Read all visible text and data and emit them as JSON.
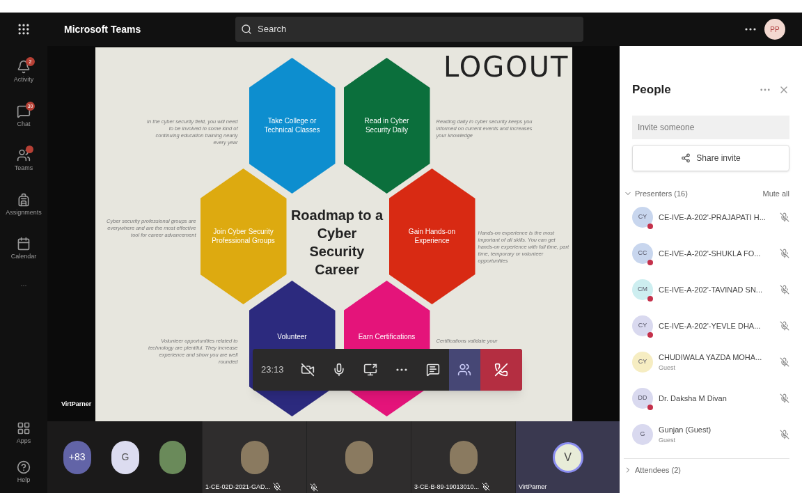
{
  "app": {
    "title": "Microsoft Teams",
    "search_placeholder": "Search",
    "user_initials": "PP"
  },
  "rail": [
    {
      "label": "Activity",
      "badge": "2"
    },
    {
      "label": "Chat",
      "badge": "30"
    },
    {
      "label": "Teams",
      "badge_dot": true
    },
    {
      "label": "Assignments"
    },
    {
      "label": "Calendar"
    },
    {
      "label": "···"
    }
  ],
  "rail_bottom": [
    {
      "label": "Apps"
    },
    {
      "label": "Help"
    }
  ],
  "slide": {
    "logo": "LOGOUT",
    "title": "Roadmap to a Cyber Security Career",
    "hexagons": [
      {
        "label": "Take College or Technical Classes",
        "color": "#0d8ecf"
      },
      {
        "label": "Read in Cyber Security Daily",
        "color": "#0b6f3c"
      },
      {
        "label": "Join Cyber Security Professional Groups",
        "color": "#ddaa10"
      },
      {
        "label": "Gain Hands-on Experience",
        "color": "#d82a13"
      },
      {
        "label": "Volunteer",
        "color": "#2c2a7e"
      },
      {
        "label": "Earn Certifications",
        "color": "#e4147a"
      }
    ],
    "notes": [
      "In the cyber security field, you will need to be involved in some kind of continuing education training nearly every year",
      "Reading daily in cyber security keeps you informed on current events and increases your knowledge",
      "Cyber security professional groups are everywhere and are the most effective tool for career advancement",
      "Hands-on experience is the most important of all skills. You can get hands-on experience with full time, part time, temporary or volunteer opportunities",
      "Volunteer opportunities related to technology are plentiful. They increase experience and show you are well rounded",
      "Certifications validate your"
    ]
  },
  "presenter_label": "VirtParner",
  "call_bar": {
    "timer": "23:13",
    "buttons": [
      {
        "kind": "camera",
        "selected": false
      },
      {
        "kind": "mic",
        "selected": false
      },
      {
        "kind": "share",
        "selected": false
      },
      {
        "kind": "more",
        "selected": false
      },
      {
        "kind": "chat",
        "selected": false
      },
      {
        "kind": "people",
        "selected": true
      },
      {
        "kind": "hangup",
        "selected": false
      }
    ]
  },
  "tiles": [
    {
      "kind": "group",
      "avatars": [
        {
          "kind": "count",
          "text": "+83"
        },
        {
          "kind": "initial",
          "text": "G"
        },
        {
          "kind": "photo"
        }
      ]
    },
    {
      "kind": "person",
      "name": "1-CE-02D-2021-GAD..."
    },
    {
      "kind": "person"
    },
    {
      "kind": "person",
      "name": "3-CE-B-89-19013010..."
    },
    {
      "kind": "initial",
      "initial": "V",
      "name": "VirtParner"
    }
  ],
  "people": {
    "title": "People",
    "invite_placeholder": "Invite someone",
    "share_button": "Share invite",
    "presenters": {
      "label": "Presenters (16)",
      "mute_all": "Mute all",
      "expanded": true,
      "members": [
        {
          "initials": "CY",
          "name": "CE-IVE-A-202'-PRAJAPATI H...",
          "color": "#c8d6ee",
          "presence_dot": true
        },
        {
          "initials": "CC",
          "name": "CE-IVE-A-202'-SHUKLA FO...",
          "color": "#c8d6ee",
          "presence_dot": true
        },
        {
          "initials": "CM",
          "name": "CE-IVE-A-202'-TAVINAD SN...",
          "color": "#cdeef0",
          "presence_dot": true
        },
        {
          "initials": "CY",
          "name": "CE-IVE-A-202'-YEVLE DHA...",
          "color": "#d9d9ef",
          "presence_dot": true
        },
        {
          "initials": "CY",
          "name": "CHUDIWALA YAZDA MOHA...",
          "subtitle": "Guest",
          "color": "#f6edc2",
          "presence_dot": false
        },
        {
          "initials": "DD",
          "name": "Dr. Daksha M Divan",
          "color": "#d9d9ef",
          "presence_dot": true
        },
        {
          "initials": "G",
          "name": "Gunjan (Guest)",
          "subtitle": "Guest",
          "color": "#d9d9ef",
          "presence_dot": false
        }
      ]
    },
    "attendees": {
      "label": "Attendees (2)",
      "expanded": false
    }
  }
}
